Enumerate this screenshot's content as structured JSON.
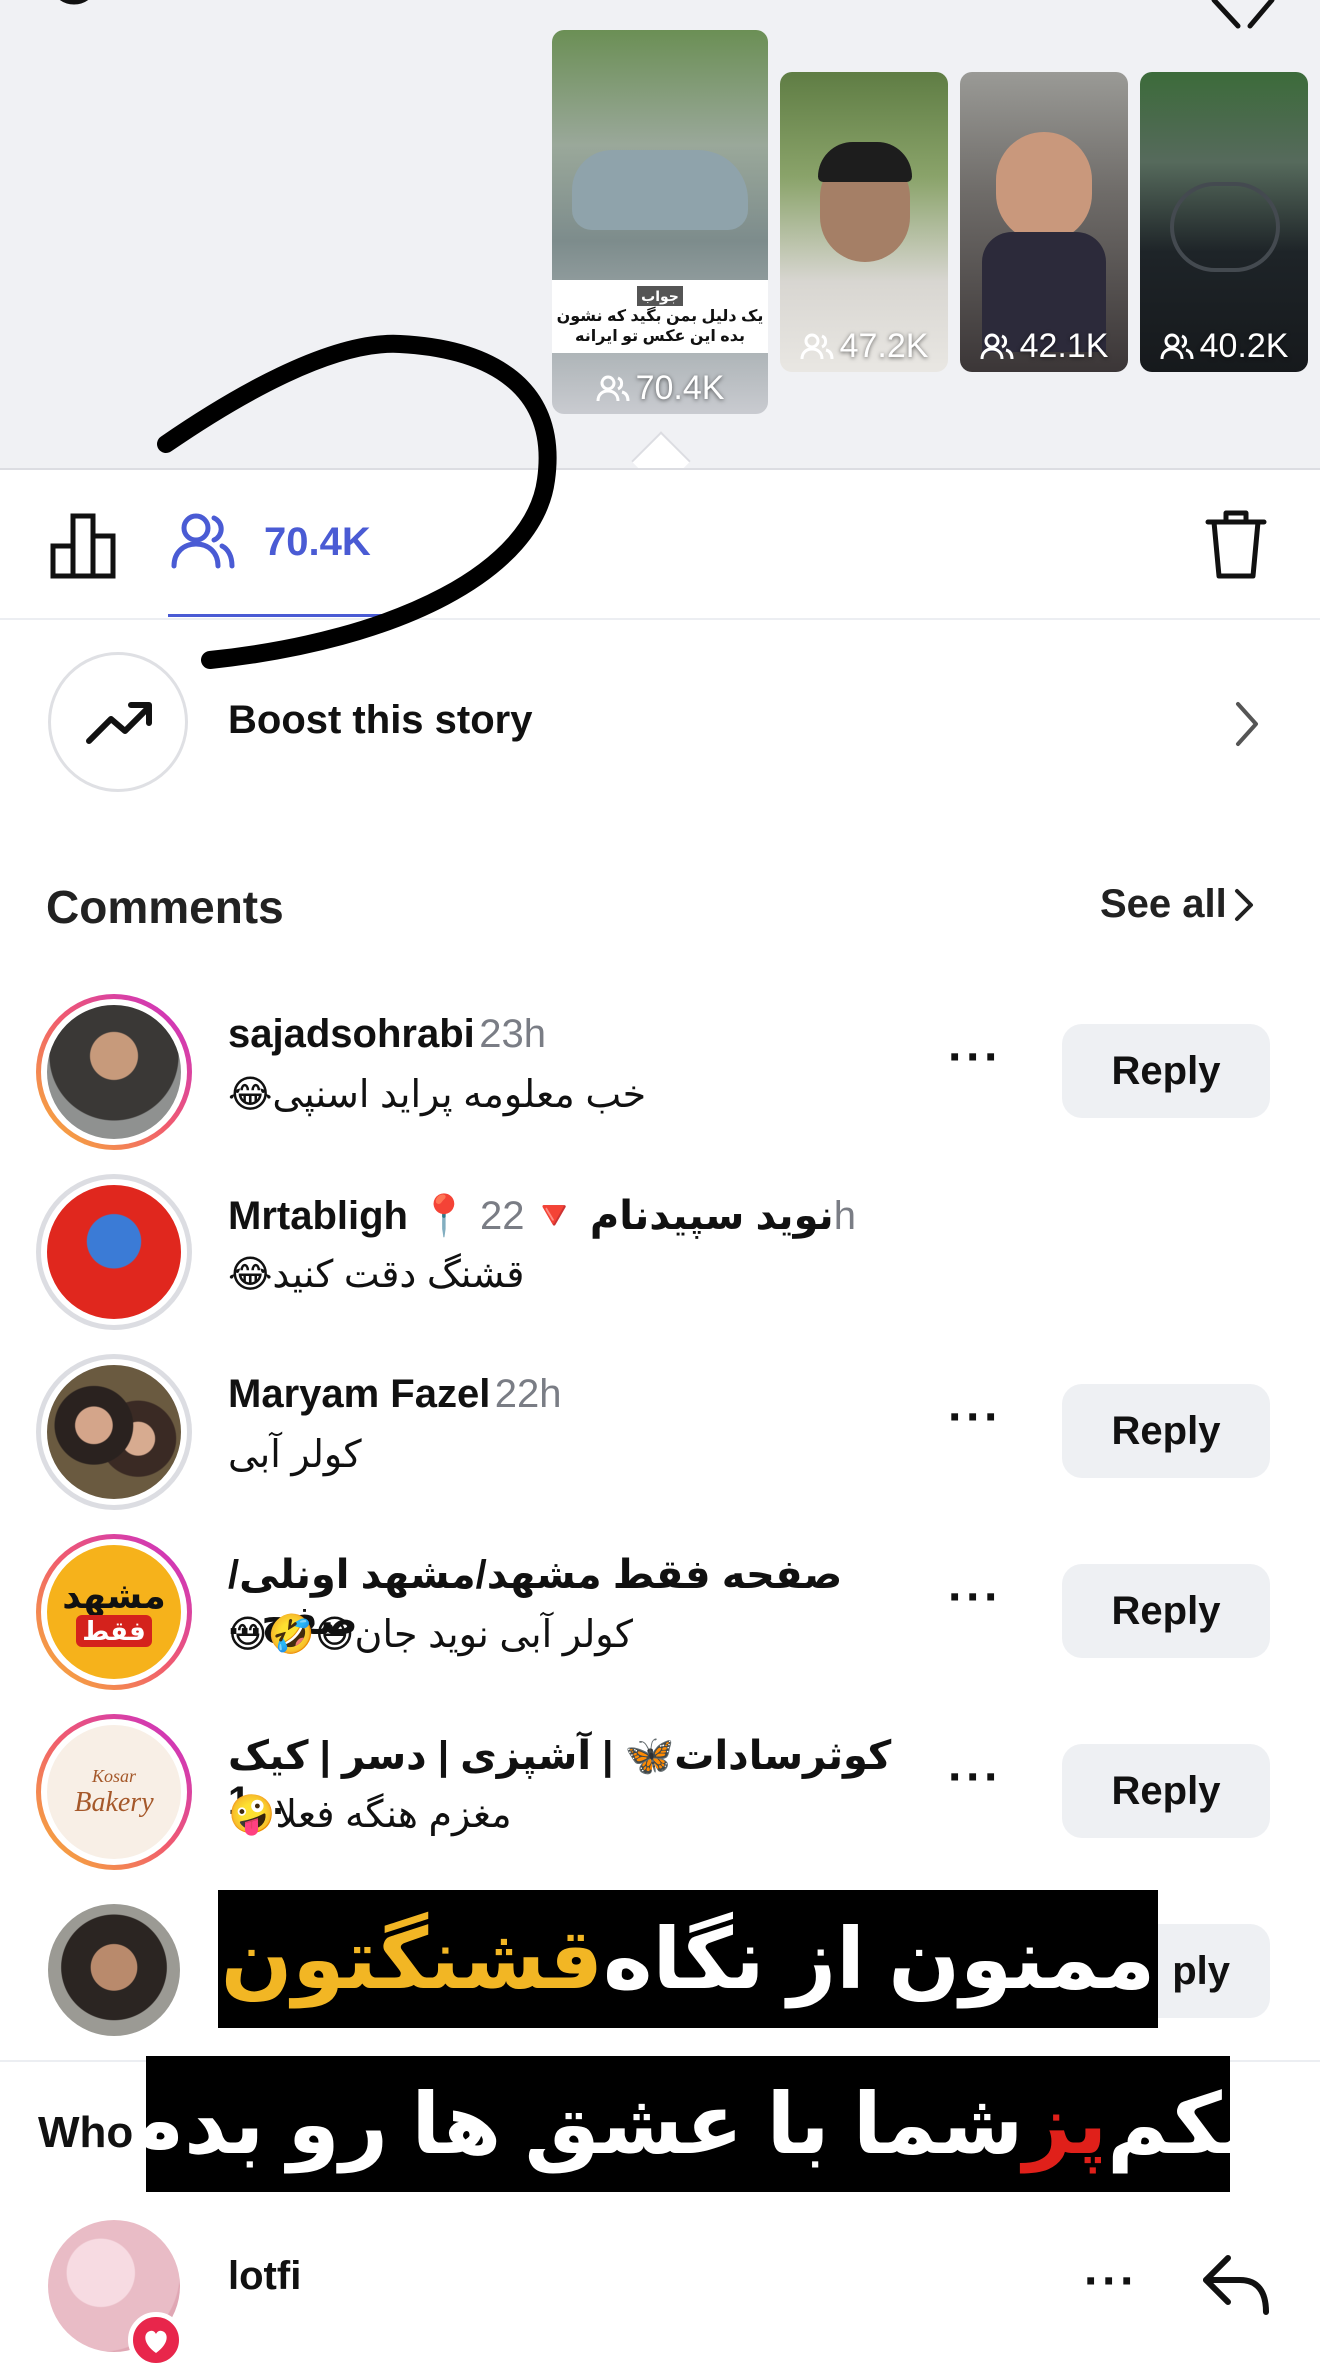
{
  "stories": {
    "thumbnails": [
      {
        "views": "70.4K",
        "caption_tag": "جواب",
        "caption": "یک دلیل بمن بگید که نشون بده این عکس تو ایرانه"
      },
      {
        "views": "47.2K"
      },
      {
        "views": "42.1K"
      },
      {
        "views": "40.2K"
      }
    ]
  },
  "tabs": {
    "viewers_count": "70.4K"
  },
  "boost": {
    "label": "Boost this story"
  },
  "comments": {
    "heading": "Comments",
    "see_all": "See all",
    "reply_label": "Reply",
    "items": [
      {
        "username": "sajadsohrabi",
        "time": "23h",
        "text": "خب معلومه پراید اسنپی😂"
      },
      {
        "username": "Mrtabligh 📍 نوید سپیدنام 🔻",
        "time": "22h",
        "text": "قشنگ دقت کنید😂"
      },
      {
        "username": "Maryam Fazel",
        "time": "22h",
        "text": "کولر آبی"
      },
      {
        "username": "صفحه فقط مشهد/مشهد اونلی/صفح...",
        "time": "",
        "text": "کولر آبی نوید جان😄🤣😄"
      },
      {
        "username": "کوثرسادات🦋 | آشپزی | دسر | کیک ...1",
        "time": "",
        "text": "مغزم هنگه فعلا🤪"
      },
      {
        "username": "",
        "time": "",
        "text": ""
      }
    ],
    "partial_reply": "ply"
  },
  "overlay": {
    "line1_white": "ممنون از نگاه ",
    "line1_highlight": "قشنگتون",
    "line2_a": "یکم ",
    "line2_highlight": "پز",
    "line2_b": " شما با عشق ها رو بدم"
  },
  "who_section": {
    "heading_partial": "Who",
    "viewer_name": "lotfi"
  },
  "avatars": {
    "mashhad_text": "مشهد",
    "mashhad_sub": "فقط",
    "kosar_text": "Kosar",
    "kosar_sub": "Bakery"
  },
  "colors": {
    "accent_blue": "#4a5bd4",
    "highlight_yellow": "#f2b624",
    "highlight_red": "#e0201a",
    "like_red": "#e8264b"
  }
}
